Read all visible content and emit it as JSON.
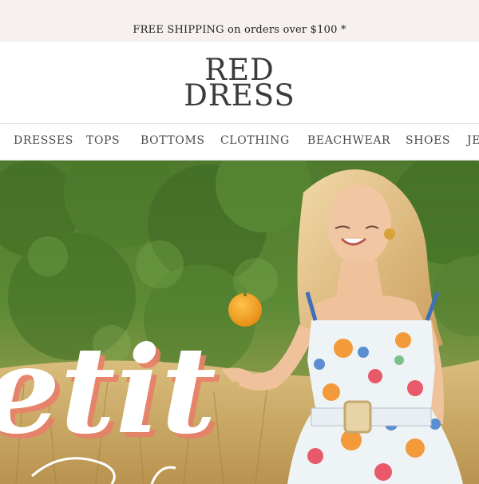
{
  "promo": {
    "text": "FREE SHIPPING on orders over $100 *"
  },
  "logo": {
    "line1": "RED",
    "line2": "DRESS"
  },
  "nav": {
    "items": [
      "DRESSES",
      "TOPS",
      "BOTTOMS",
      "CLOTHING",
      "BEACHWEAR",
      "SHOES",
      "JE"
    ]
  },
  "hero": {
    "script_text": "etit"
  },
  "colors": {
    "promo_bg": "#f6f1ee",
    "accent_coral": "#e8806a",
    "orange": "#f5a623"
  }
}
